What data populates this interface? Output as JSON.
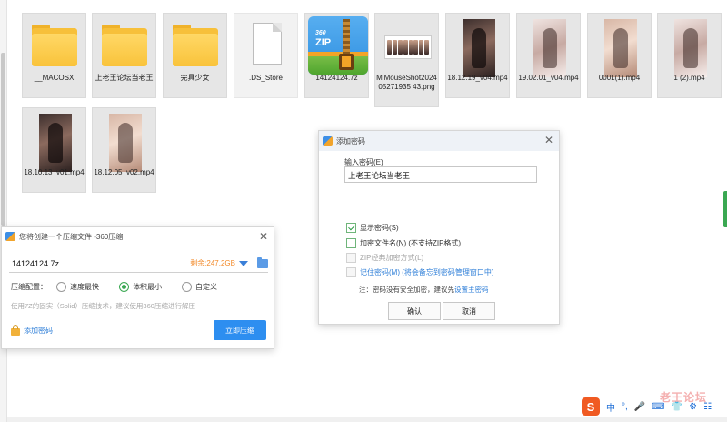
{
  "files": [
    {
      "name": "__MACOSX",
      "icon": "folder-icon"
    },
    {
      "name": "上老王论坛当老王",
      "icon": "folder-icon"
    },
    {
      "name": "完具少女",
      "icon": "folder-icon"
    },
    {
      "name": ".DS_Store",
      "icon": "file-icon"
    },
    {
      "name": "14124124.7z",
      "icon": "zip-archive-icon"
    },
    {
      "name": "MiMouseShot202405271935 43.png",
      "icon": "image-icon"
    },
    {
      "name": "18.12.19_v04.mp4",
      "icon": "video-thumbnail"
    },
    {
      "name": "19.02.01_v04.mp4",
      "icon": "video-thumbnail"
    },
    {
      "name": "0001(1).mp4",
      "icon": "video-thumbnail"
    },
    {
      "name": "1 (2).mp4",
      "icon": "video-thumbnail"
    },
    {
      "name": "18.10.13_v01.mp4",
      "icon": "video-thumbnail"
    },
    {
      "name": "18.12.05_v02.mp4",
      "icon": "video-thumbnail"
    }
  ],
  "create_dialog": {
    "title": "您将创建一个压缩文件 -360压缩",
    "file_name": "14124124.7z",
    "space_left": "剩余:247.2GB",
    "config_label": "压缩配置：",
    "options": [
      "速度最快",
      "体积最小",
      "自定义"
    ],
    "selected_option": "体积最小",
    "hint": "使用7Z的固实（Solid）压缩技术，建议使用360压缩进行解压",
    "add_password": "添加密码",
    "compress_now": "立即压缩"
  },
  "password_dialog": {
    "title": "添加密码",
    "input_label": "输入密码(E)",
    "password_value": "上老王论坛当老王",
    "show_password": "显示密码(S)",
    "show_password_checked": true,
    "encrypt_names": "加密文件名(N) (不支持ZIP格式)",
    "encrypt_names_checked": false,
    "zip_classic": "ZIP经典加密方式(L)",
    "remember_password": "记住密码(M) (将会备忘到密码管理窗口中)",
    "note_prefix": "注：密码没有安全加密，建议先",
    "note_link": "设置主密码",
    "ok": "确认",
    "cancel": "取消"
  },
  "ime": {
    "logo": "S",
    "items": [
      "中",
      "°,",
      "🎤",
      "⌨",
      "👕",
      "⚙",
      "☷"
    ]
  },
  "watermark": "老王论坛"
}
